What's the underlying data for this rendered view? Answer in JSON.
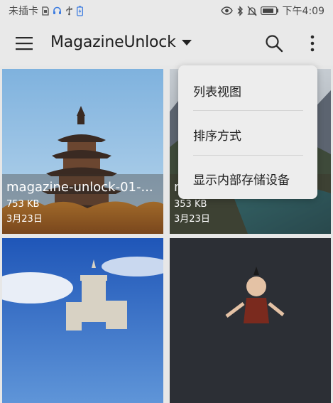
{
  "status_bar": {
    "carrier": "未插卡",
    "time": "下午4:09",
    "icons": [
      "sim-card-icon",
      "headset-icon",
      "usb-icon",
      "battery-charging-icon",
      "eye-icon",
      "bluetooth-icon",
      "mute-bell-icon",
      "battery-icon"
    ]
  },
  "app_bar": {
    "title": "MagazineUnlock",
    "menu_icon": "hamburger-menu-icon",
    "dropdown_icon": "triangle-down-icon",
    "search_icon": "search-icon",
    "more_icon": "more-vertical-icon"
  },
  "images": [
    {
      "name": "magazine-unlock-01-...",
      "size": "753 KB",
      "date": "3月23日"
    },
    {
      "name": "m",
      "size": "353 KB",
      "date": "3月23日"
    },
    {
      "name": "",
      "size": "",
      "date": ""
    },
    {
      "name": "",
      "size": "",
      "date": ""
    }
  ],
  "popup_menu": {
    "items": [
      "列表视图",
      "排序方式",
      "显示内部存储设备"
    ]
  },
  "colors": {
    "status_bar_bg": "#e9e9e9",
    "app_bar_bg": "#e9e9e9",
    "popup_bg": "#ededed",
    "caption_text": "#ffffff"
  }
}
